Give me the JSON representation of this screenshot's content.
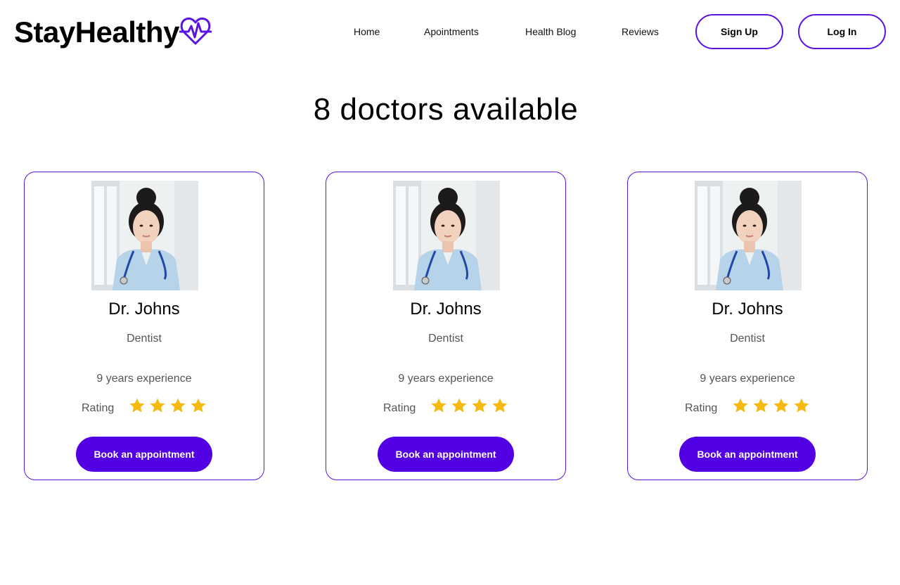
{
  "brand": {
    "name": "StayHealthy",
    "accent_color": "#5a13e0",
    "icon": "heart-pulse-icon"
  },
  "nav": {
    "items": [
      {
        "label": "Home"
      },
      {
        "label": "Apointments"
      },
      {
        "label": "Health Blog"
      },
      {
        "label": "Reviews"
      }
    ],
    "sign_up_label": "Sign Up",
    "log_in_label": "Log  In"
  },
  "main": {
    "title": "8 doctors available",
    "doctors": [
      {
        "name": "Dr. Johns",
        "specialty": "Dentist",
        "experience": "9 years experience",
        "rating_label": "Rating",
        "stars": 4,
        "book_label": "Book an appointment",
        "photo_icon": "doctor-photo"
      },
      {
        "name": "Dr. Johns",
        "specialty": "Dentist",
        "experience": "9 years experience",
        "rating_label": "Rating",
        "stars": 4,
        "book_label": "Book an appointment",
        "photo_icon": "doctor-photo"
      },
      {
        "name": "Dr. Johns",
        "specialty": "Dentist",
        "experience": "9 years experience",
        "rating_label": "Rating",
        "stars": 4,
        "book_label": "Book an appointment",
        "photo_icon": "doctor-photo"
      }
    ]
  },
  "colors": {
    "button_fill": "#5200e3",
    "star": "#f5b90f",
    "muted_text": "#555555"
  }
}
